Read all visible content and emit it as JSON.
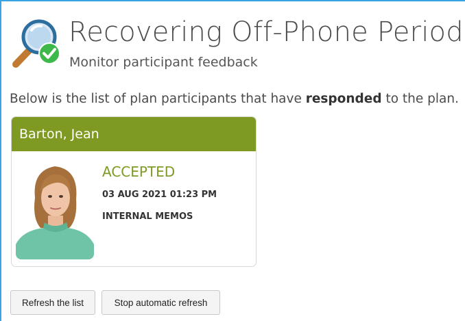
{
  "header": {
    "title": "Recovering Off-Phone Periods",
    "subtitle": "Monitor participant feedback"
  },
  "intro": {
    "before": "Below is the list of plan participants that have ",
    "emphasis": "responded",
    "after": " to the plan."
  },
  "participant": {
    "name": "Barton, Jean",
    "status": "ACCEPTED",
    "datetime": "03 AUG 2021 01:23 PM",
    "channel": "INTERNAL MEMOS"
  },
  "buttons": {
    "refresh": "Refresh the list",
    "stop": "Stop automatic refresh"
  },
  "colors": {
    "accent": "#7e9a22",
    "frame": "#3aa3e3"
  },
  "icons": {
    "logo": "magnifier-check-icon"
  }
}
